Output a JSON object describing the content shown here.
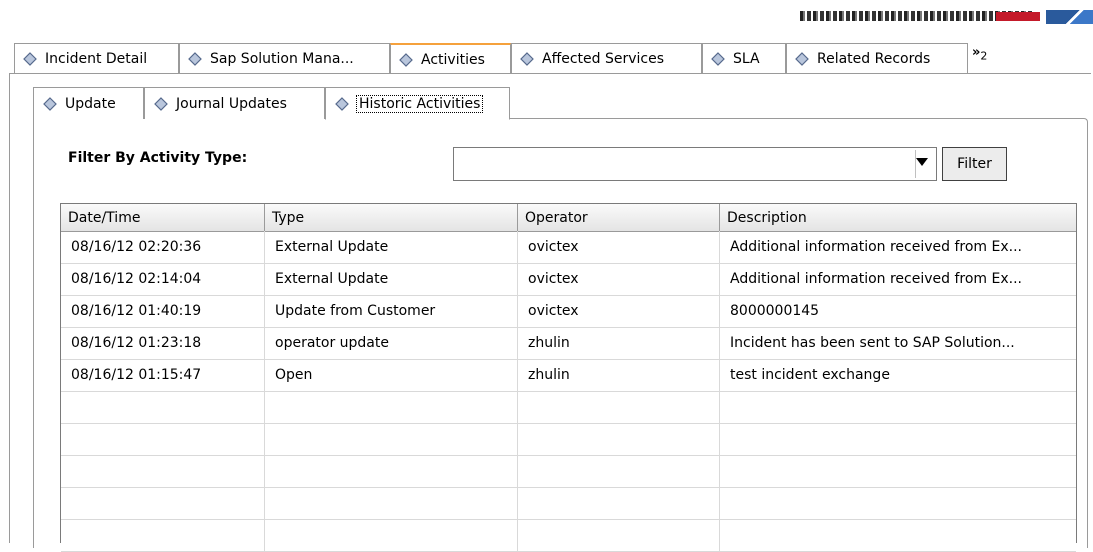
{
  "main_tabs": [
    {
      "label": "Incident Detail"
    },
    {
      "label": "Sap Solution Mana..."
    },
    {
      "label": "Activities"
    },
    {
      "label": "Affected Services"
    },
    {
      "label": "SLA"
    },
    {
      "label": "Related Records"
    }
  ],
  "overflow": {
    "chevron": "»",
    "count": "2"
  },
  "sub_tabs": [
    {
      "label": "Update"
    },
    {
      "label": "Journal Updates"
    },
    {
      "label": "Historic Activities"
    }
  ],
  "filter": {
    "label": "Filter By Activity Type:",
    "value": "",
    "button_label": "Filter"
  },
  "table": {
    "columns": [
      "Date/Time",
      "Type",
      "Operator",
      "Description"
    ],
    "rows": [
      [
        "08/16/12 02:20:36",
        "External Update",
        "ovictex",
        "Additional information received from Ex..."
      ],
      [
        "08/16/12 02:14:04",
        "External Update",
        "ovictex",
        "Additional information received from Ex..."
      ],
      [
        "08/16/12 01:40:19",
        "Update from Customer",
        "ovictex",
        "8000000145"
      ],
      [
        "08/16/12 01:23:18",
        "operator update",
        "zhulin",
        "Incident has been sent to SAP Solution..."
      ],
      [
        "08/16/12 01:15:47",
        "Open",
        "zhulin",
        "test incident exchange"
      ]
    ]
  },
  "colors": {
    "active_tab_accent": "#f5a13c",
    "tab_icon": "#7a8fb0"
  }
}
